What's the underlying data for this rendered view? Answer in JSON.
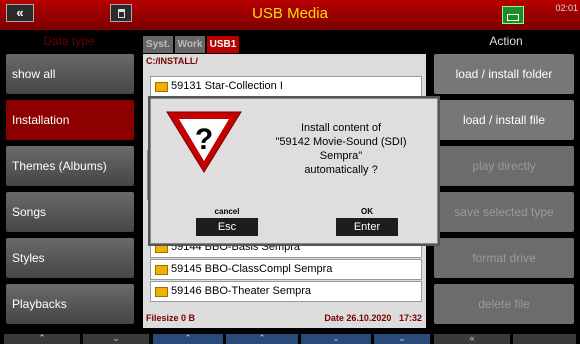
{
  "header": {
    "back_icon": "«",
    "title": "USB Media",
    "clock": "02:01"
  },
  "left_panel": {
    "title": "Data type",
    "items": [
      {
        "label": "show all",
        "active": false
      },
      {
        "label": "Installation",
        "active": true
      },
      {
        "label": "Themes (Albums)",
        "active": false
      },
      {
        "label": "Songs",
        "active": false
      },
      {
        "label": "Styles",
        "active": false
      },
      {
        "label": "Playbacks",
        "active": false
      }
    ]
  },
  "tabs": [
    {
      "label": "Syst.",
      "active": false
    },
    {
      "label": "Work",
      "active": false
    },
    {
      "label": "USB1",
      "active": true
    }
  ],
  "browser": {
    "path": "C:/INSTALL/",
    "files": [
      {
        "label": "59131 Star-Collection I"
      },
      {
        "label": "59144 BBO-Basis Sempra"
      },
      {
        "label": "59145 BBO-ClassCompl Sempra"
      },
      {
        "label": "59146 BBO-Theater Sempra"
      }
    ],
    "filesize": "Filesize 0 B",
    "date": "Date 26.10.2020",
    "time": "17:32"
  },
  "right_panel": {
    "title": "Action",
    "items": [
      {
        "label": "load / install folder",
        "enabled": true
      },
      {
        "label": "load / install file",
        "enabled": true
      },
      {
        "label": "play directly",
        "enabled": false
      },
      {
        "label": "save selected type",
        "enabled": false
      },
      {
        "label": "format drive",
        "enabled": false
      },
      {
        "label": "delete file",
        "enabled": false
      }
    ]
  },
  "dialog": {
    "message": [
      "Install content of",
      "\"59142 Movie-Sound (SDI)",
      "Sempra\"",
      "automatically ?"
    ],
    "cancel_caption": "cancel",
    "cancel_button": "Esc",
    "ok_caption": "OK",
    "ok_button": "Enter"
  },
  "bottom_bar": {
    "buttons": [
      "⌃",
      "⌄",
      "⌃",
      "⌃",
      "⌄",
      "⌄",
      "«"
    ]
  }
}
